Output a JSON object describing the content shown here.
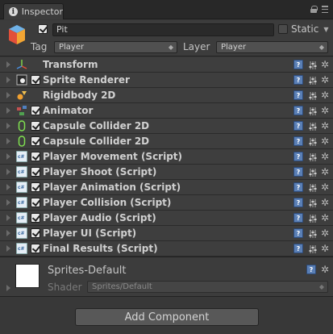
{
  "window": {
    "tab_label": "Inspector"
  },
  "header": {
    "object_name": "Pit",
    "active": true,
    "static_label": "Static",
    "static_checked": false,
    "tag_label": "Tag",
    "tag_value": "Player",
    "layer_label": "Layer",
    "layer_value": "Player"
  },
  "components": [
    {
      "name": "Transform",
      "icon": "transform-icon",
      "has_toggle": false
    },
    {
      "name": "Sprite Renderer",
      "icon": "sprite-renderer-icon",
      "has_toggle": true,
      "enabled": true
    },
    {
      "name": "Rigidbody 2D",
      "icon": "rigidbody2d-icon",
      "has_toggle": false
    },
    {
      "name": "Animator",
      "icon": "animator-icon",
      "has_toggle": true,
      "enabled": true
    },
    {
      "name": "Capsule Collider 2D",
      "icon": "capsule-collider-icon",
      "has_toggle": true,
      "enabled": true
    },
    {
      "name": "Capsule Collider 2D",
      "icon": "capsule-collider-icon",
      "has_toggle": true,
      "enabled": true
    },
    {
      "name": "Player Movement (Script)",
      "icon": "script-icon",
      "has_toggle": true,
      "enabled": true
    },
    {
      "name": "Player Shoot (Script)",
      "icon": "script-icon",
      "has_toggle": true,
      "enabled": true
    },
    {
      "name": "Player Animation (Script)",
      "icon": "script-icon",
      "has_toggle": true,
      "enabled": true
    },
    {
      "name": "Player Collision (Script)",
      "icon": "script-icon",
      "has_toggle": true,
      "enabled": true
    },
    {
      "name": "Player Audio (Script)",
      "icon": "script-icon",
      "has_toggle": true,
      "enabled": true
    },
    {
      "name": "Player UI (Script)",
      "icon": "script-icon",
      "has_toggle": true,
      "enabled": true
    },
    {
      "name": "Final Results (Script)",
      "icon": "script-icon",
      "has_toggle": true,
      "enabled": true
    }
  ],
  "material": {
    "name": "Sprites-Default",
    "shader_label": "Shader",
    "shader_value": "Sprites/Default"
  },
  "add_component_label": "Add Component",
  "help_glyph": "?",
  "gear_glyph": "✲",
  "colors": {
    "background": "#383838",
    "help_blue": "#5a7fb5",
    "text": "#c4c4c4"
  }
}
